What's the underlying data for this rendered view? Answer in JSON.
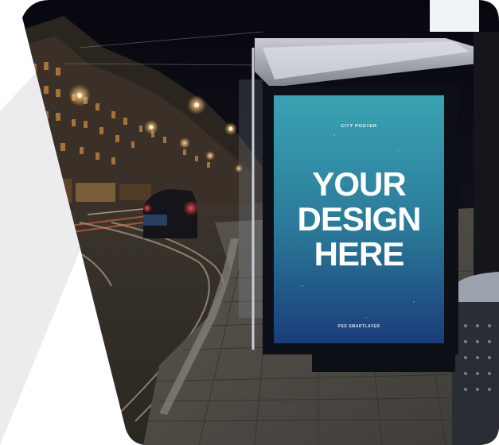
{
  "poster": {
    "kicker": "CITY POSTER",
    "headline": [
      "YOUR",
      "DESIGN",
      "HERE"
    ],
    "brand": "PSD SMARTLAYER"
  },
  "colors": {
    "poster_top": "#3aa3b4",
    "poster_bottom": "#1a3d7a",
    "night_sky": "#0b0c16",
    "street_light": "#ffb85a",
    "slab_gray": "#ececef"
  },
  "icons": {
    "trash_bin": "trash-bin-icon"
  }
}
